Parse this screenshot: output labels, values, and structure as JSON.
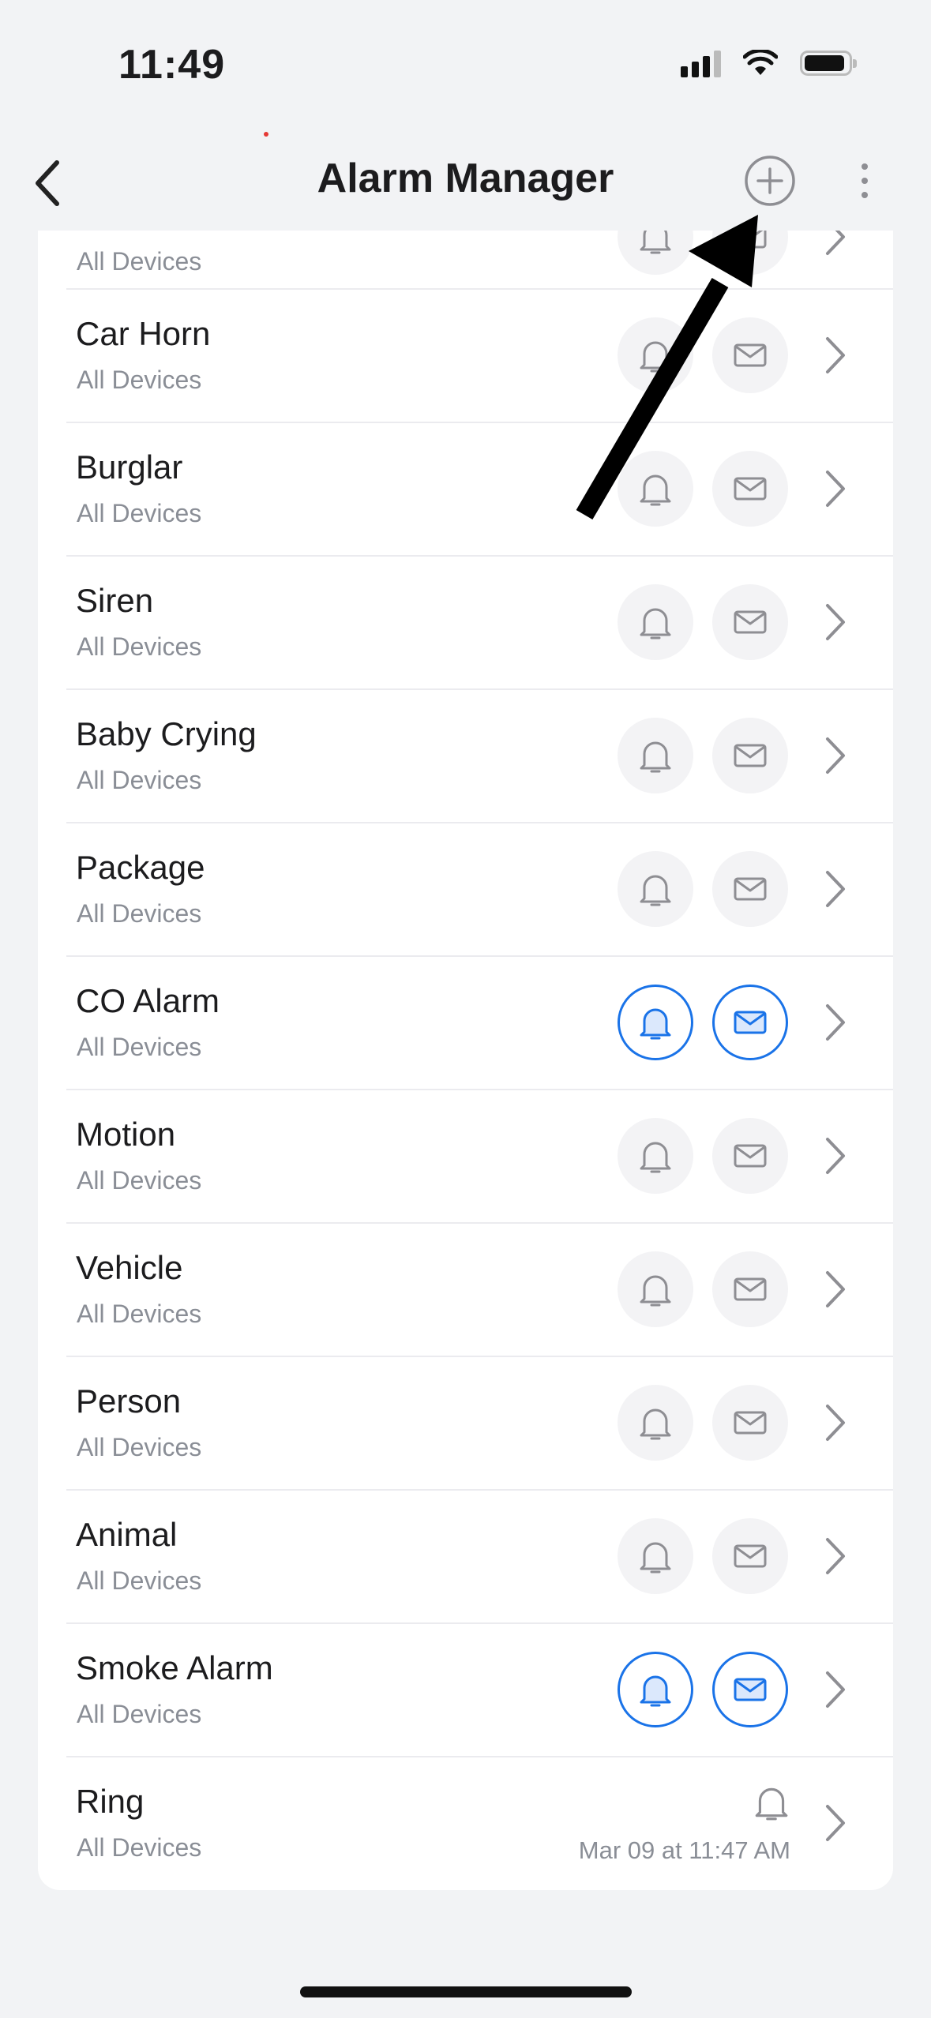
{
  "status_bar": {
    "time": "11:49"
  },
  "header": {
    "title": "Alarm Manager"
  },
  "alarms": [
    {
      "name": "",
      "subtitle": "All Devices"
    },
    {
      "name": "Car Horn",
      "subtitle": "All Devices",
      "active": false
    },
    {
      "name": "Burglar",
      "subtitle": "All Devices",
      "active": false
    },
    {
      "name": "Siren",
      "subtitle": "All Devices",
      "active": false
    },
    {
      "name": "Baby Crying",
      "subtitle": "All Devices",
      "active": false
    },
    {
      "name": "Package",
      "subtitle": "All Devices",
      "active": false
    },
    {
      "name": "CO Alarm",
      "subtitle": "All Devices",
      "active": true
    },
    {
      "name": "Motion",
      "subtitle": "All Devices",
      "active": false
    },
    {
      "name": "Vehicle",
      "subtitle": "All Devices",
      "active": false
    },
    {
      "name": "Person",
      "subtitle": "All Devices",
      "active": false
    },
    {
      "name": "Animal",
      "subtitle": "All Devices",
      "active": false
    },
    {
      "name": "Smoke Alarm",
      "subtitle": "All Devices",
      "active": true
    },
    {
      "name": "Ring",
      "subtitle": "All Devices",
      "timestamp": "Mar 09 at 11:47 AM"
    }
  ],
  "colors": {
    "accent": "#1a73e8",
    "inactive_icon": "#8e8e93",
    "annotation_arrow": "#000000"
  }
}
